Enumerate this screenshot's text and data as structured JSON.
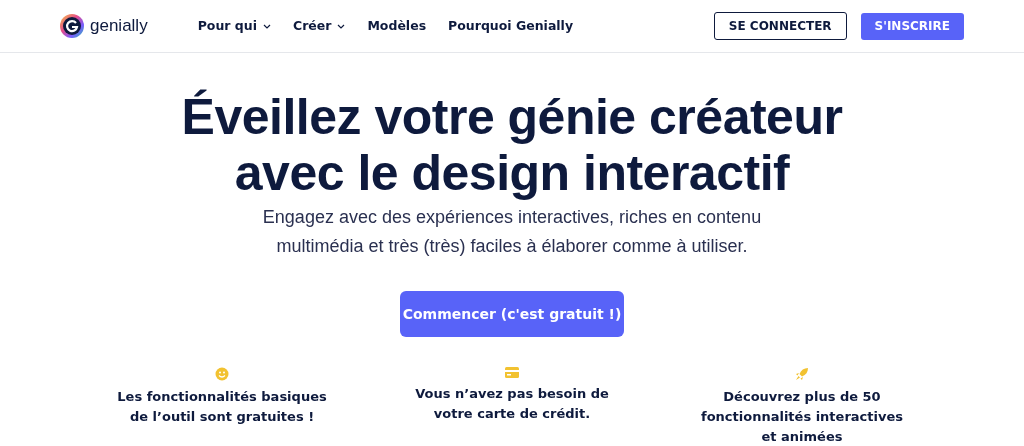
{
  "brand": {
    "name": "genially"
  },
  "nav": [
    {
      "label": "Pour qui",
      "kind": "dropdown"
    },
    {
      "label": "Créer",
      "kind": "dropdown"
    },
    {
      "label": "Modèles",
      "kind": "link"
    },
    {
      "label": "Pourquoi Genially",
      "kind": "link"
    }
  ],
  "actions": [
    {
      "label": "SE CONNECTER",
      "kind": "outline"
    },
    {
      "label": "S'INSCRIRE",
      "kind": "primary"
    }
  ],
  "hero": {
    "title_lines": [
      "Éveillez votre génie créateur",
      "avec le design interactif"
    ],
    "subtitle_lines": [
      "Engagez avec des expériences interactives, riches en contenu",
      "multimédia et très (très) faciles à élaborer comme à utiliser."
    ],
    "cta": "Commencer (c'est gratuit !)"
  },
  "features": [
    {
      "kind": "smile",
      "text": "Les fonctionnalités basiques de l’outil sont gratuites !"
    },
    {
      "kind": "card",
      "text": "Vous n’avez pas besoin de votre carte de crédit."
    },
    {
      "kind": "rocket",
      "text": "Découvrez plus de 50 fonctionnalités interactives et animées"
    }
  ]
}
